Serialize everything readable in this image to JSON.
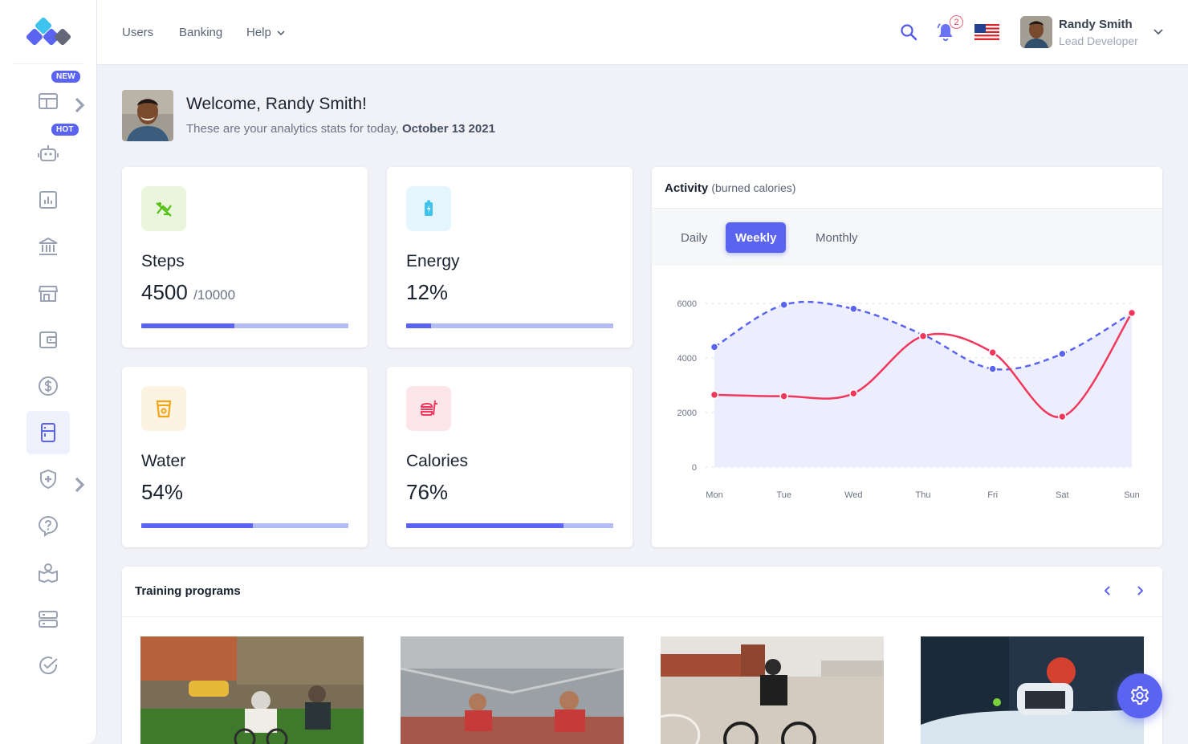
{
  "sidebar": {
    "badges": {
      "new": "NEW",
      "hot": "HOT"
    },
    "items": [
      {
        "icon": "layout-icon",
        "badge": "new",
        "has_arrow": true
      },
      {
        "icon": "robot-icon",
        "badge": "hot"
      },
      {
        "icon": "chart-icon"
      },
      {
        "icon": "bank-icon"
      },
      {
        "icon": "store-icon"
      },
      {
        "icon": "wallet-icon"
      },
      {
        "icon": "dollar-icon"
      },
      {
        "icon": "fridge-icon",
        "active": true
      },
      {
        "icon": "shield-plus-icon",
        "has_arrow": true
      },
      {
        "icon": "help-icon"
      },
      {
        "icon": "map-user-icon"
      },
      {
        "icon": "server-icon"
      },
      {
        "icon": "check-circle-icon"
      }
    ]
  },
  "header": {
    "nav": {
      "users": "Users",
      "banking": "Banking",
      "help": "Help"
    },
    "notifications_count": "2",
    "user": {
      "name": "Randy Smith",
      "role": "Lead Developer"
    }
  },
  "welcome": {
    "title": "Welcome, Randy Smith!",
    "subtitle": "These are your analytics stats for today,",
    "date": "October 13 2021"
  },
  "stats": {
    "steps": {
      "title": "Steps",
      "value": "4500",
      "suffix": "/10000",
      "progress": 0.45,
      "icon": "steps-icon"
    },
    "energy": {
      "title": "Energy",
      "value": "12%",
      "progress": 0.12,
      "icon": "battery-icon"
    },
    "water": {
      "title": "Water",
      "value": "54%",
      "progress": 0.54,
      "icon": "cup-icon"
    },
    "calories": {
      "title": "Calories",
      "value": "76%",
      "progress": 0.76,
      "icon": "food-icon"
    }
  },
  "activity": {
    "title": "Activity",
    "subtitle": "(burned calories)",
    "tabs": {
      "daily": "Daily",
      "weekly": "Weekly",
      "monthly": "Monthly"
    },
    "active_tab": "Weekly"
  },
  "chart_data": {
    "type": "line",
    "categories": [
      "Mon",
      "Tue",
      "Wed",
      "Thu",
      "Fri",
      "Sat",
      "Sun"
    ],
    "ylim": [
      0,
      6000
    ],
    "yticks": [
      "0",
      "2000",
      "4000",
      "6000"
    ],
    "grid": true,
    "series": [
      {
        "style": "dashed-area",
        "color": "#5a64f0",
        "values": [
          4400,
          5950,
          5800,
          4850,
          3600,
          4150,
          5650
        ]
      },
      {
        "style": "solid",
        "color": "#f1385c",
        "values": [
          2650,
          2600,
          2700,
          4800,
          4200,
          1850,
          5650
        ]
      }
    ]
  },
  "training": {
    "title": "Training programs",
    "photos": [
      "city cycling",
      "sprinters at start line",
      "road cyclist",
      "snowboarder"
    ]
  },
  "colors": {
    "accent": "#5a64f0",
    "danger": "#f1385c",
    "progress_track": "#b3bcf5"
  }
}
